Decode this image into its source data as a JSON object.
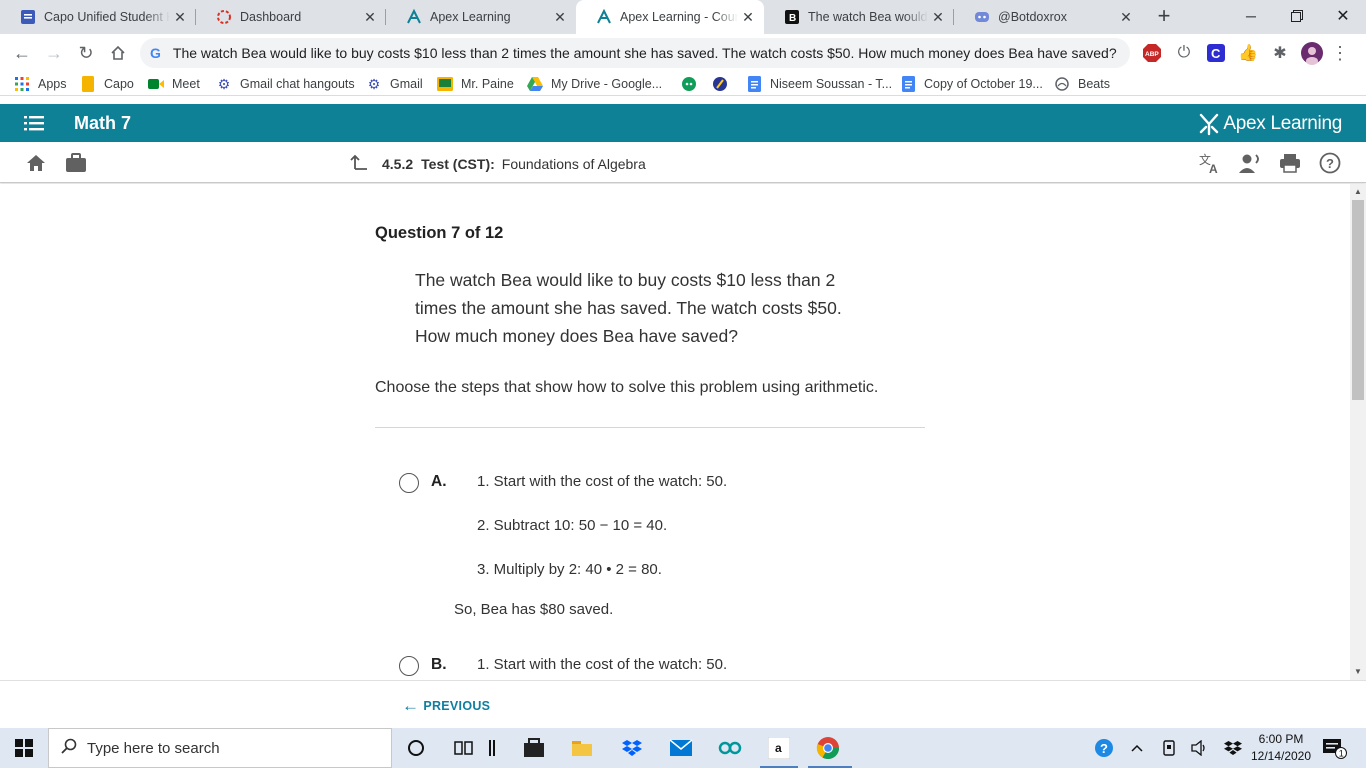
{
  "browser": {
    "tabs": [
      {
        "label": "Capo Unified Student H",
        "icon": "docs-icon"
      },
      {
        "label": "Dashboard",
        "icon": "dashboard-icon"
      },
      {
        "label": "Apex Learning",
        "icon": "apex-icon"
      },
      {
        "label": "Apex Learning - Course",
        "icon": "apex-icon"
      },
      {
        "label": "The watch Bea would lik",
        "icon": "brainly-icon"
      },
      {
        "label": "@Botdoxrox",
        "icon": "discord-icon"
      }
    ],
    "new_tab": "+",
    "address": "The watch Bea would like to buy costs $10 less than 2 times the amount she has saved. The watch costs $50. How much money does Bea have saved?",
    "search_engine_glyph": "G",
    "abp_label": "ABP",
    "ext_c_label": "C",
    "bookmarks": [
      {
        "label": "Apps"
      },
      {
        "label": "Capo"
      },
      {
        "label": "Meet"
      },
      {
        "label": "Gmail chat hangouts"
      },
      {
        "label": "Gmail"
      },
      {
        "label": "Mr. Paine"
      },
      {
        "label": "My Drive - Google..."
      },
      {
        "label": "Niseem Soussan - T..."
      },
      {
        "label": "Copy of October 19..."
      },
      {
        "label": "Beats"
      }
    ]
  },
  "app": {
    "course_title": "Math 7",
    "brand": "Apex Learning",
    "breadcrumb": {
      "number": "4.5.2",
      "kind": "Test (CST):",
      "title": "Foundations of Algebra"
    }
  },
  "question": {
    "heading": "Question 7 of 12",
    "prompt_lines": [
      "The watch Bea would like to buy costs $10 less than 2",
      "times the amount she has saved. The watch costs $50.",
      "How much money does Bea have saved?"
    ],
    "instruction": "Choose the steps that show how to solve this problem using arithmetic.",
    "options": [
      {
        "letter": "A.",
        "steps": [
          "1. Start with the cost of the watch: 50.",
          "2. Subtract 10: 50 − 10 = 40.",
          "3. Multiply by 2: 40 • 2 = 80."
        ],
        "conclusion": "So, Bea has $80 saved."
      },
      {
        "letter": "B.",
        "steps": [
          "1. Start with the cost of the watch: 50."
        ]
      }
    ]
  },
  "footer": {
    "previous_label": "PREVIOUS"
  },
  "taskbar": {
    "search_placeholder": "Type here to search",
    "amazon_label": "a",
    "time": "6:00 PM",
    "date": "12/14/2020",
    "notification_count": "1"
  },
  "colors": {
    "apex_teal": "#0f8196",
    "link_blue": "#0f7ea0"
  }
}
